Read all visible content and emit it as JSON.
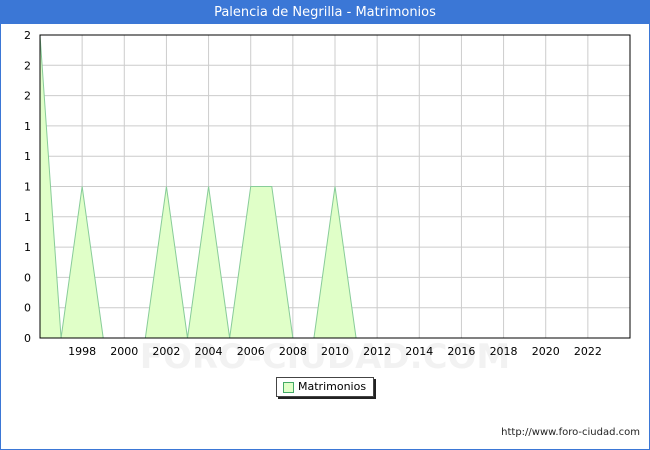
{
  "title": "Palencia de Negrilla - Matrimonios",
  "watermark": "FORO-CIUDAD.COM",
  "url": "http://www.foro-ciudad.com",
  "colors": {
    "header": "#3b77d6",
    "fill": "#e0ffc8",
    "line": "#88cc99",
    "grid": "#cccccc"
  },
  "chart_data": {
    "type": "area",
    "title": "Palencia de Negrilla - Matrimonios",
    "xlabel": "",
    "ylabel": "",
    "xlim": [
      1996,
      2024
    ],
    "ylim": [
      0,
      2
    ],
    "x_ticks": [
      1998,
      2000,
      2002,
      2004,
      2006,
      2008,
      2010,
      2012,
      2014,
      2016,
      2018,
      2020,
      2022
    ],
    "y_tick_labels": [
      "0",
      "0",
      "0",
      "1",
      "1",
      "1",
      "1",
      "1",
      "2",
      "2",
      "2"
    ],
    "grid": true,
    "legend_position": "bottom-center",
    "series": [
      {
        "name": "Matrimonios",
        "x": [
          1996,
          1997,
          1998,
          1999,
          2000,
          2001,
          2002,
          2003,
          2004,
          2005,
          2006,
          2007,
          2008,
          2009,
          2010,
          2011,
          2012,
          2013,
          2014,
          2015,
          2016,
          2017,
          2018,
          2019,
          2020,
          2021,
          2022,
          2023
        ],
        "values": [
          2,
          0,
          1,
          0,
          0,
          0,
          1,
          0,
          1,
          0,
          1,
          1,
          0,
          0,
          1,
          0,
          0,
          0,
          0,
          0,
          0,
          0,
          0,
          0,
          0,
          0,
          0,
          0
        ]
      }
    ]
  }
}
